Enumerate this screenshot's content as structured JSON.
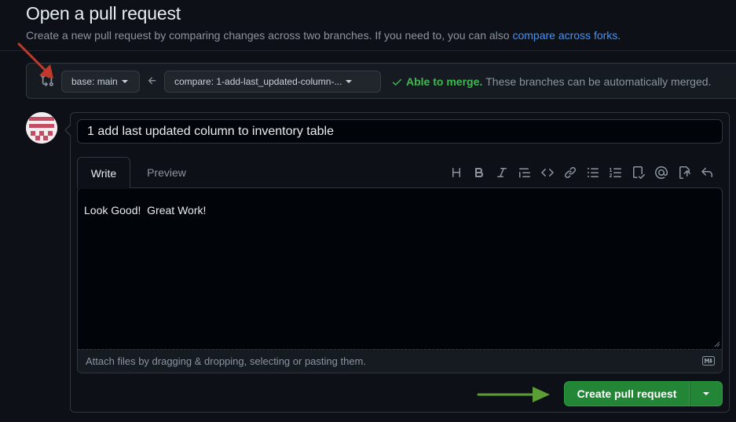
{
  "header": {
    "title": "Open a pull request",
    "subtitle_prefix": "Create a new pull request by comparing changes across two branches. If you need to, you can also",
    "subtitle_link": "compare across forks",
    "subtitle_suffix": "."
  },
  "compare": {
    "base_label": "base: main",
    "compare_label": "compare: 1-add-last_updated-column-...",
    "merge_status": "Able to merge.",
    "merge_detail": "These branches can be automatically merged."
  },
  "pr": {
    "title_value": "1 add last updated column to inventory table",
    "tabs": {
      "write": "Write",
      "preview": "Preview"
    },
    "body": "Look Good!  Great Work!",
    "attach_hint": "Attach files by dragging & dropping, selecting or pasting them.",
    "create_button": "Create pull request"
  },
  "toolbar": {
    "icons": [
      "heading-icon",
      "bold-icon",
      "italic-icon",
      "quote-icon",
      "code-icon",
      "link-icon",
      "unordered-list-icon",
      "ordered-list-icon",
      "task-list-icon",
      "mention-icon",
      "cross-reference-icon",
      "reply-icon"
    ]
  },
  "colors": {
    "background": "#0d1117",
    "accent_link": "#4493f8",
    "success": "#3fb950",
    "primary_button": "#238636",
    "annotation_red": "#c0392b",
    "annotation_green": "#5a9e35"
  }
}
